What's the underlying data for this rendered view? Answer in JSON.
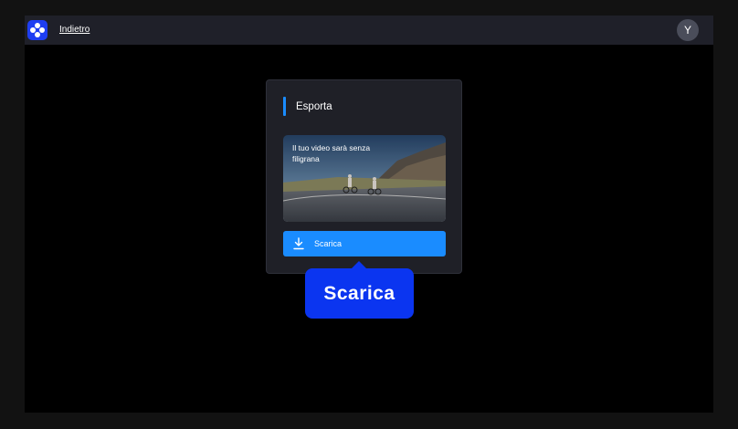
{
  "topbar": {
    "back_label": "Indietro",
    "avatar_initial": "Y"
  },
  "export_panel": {
    "title": "Esporta",
    "preview_text": "Il tuo video sarà senza filigrana",
    "download_label": "Scarica"
  },
  "tooltip": {
    "text": "Scarica"
  },
  "colors": {
    "accent": "#1a8cff",
    "brand": "#1e3ef2",
    "tooltip_bg": "#0b35f0",
    "panel_bg": "#1f2027"
  }
}
